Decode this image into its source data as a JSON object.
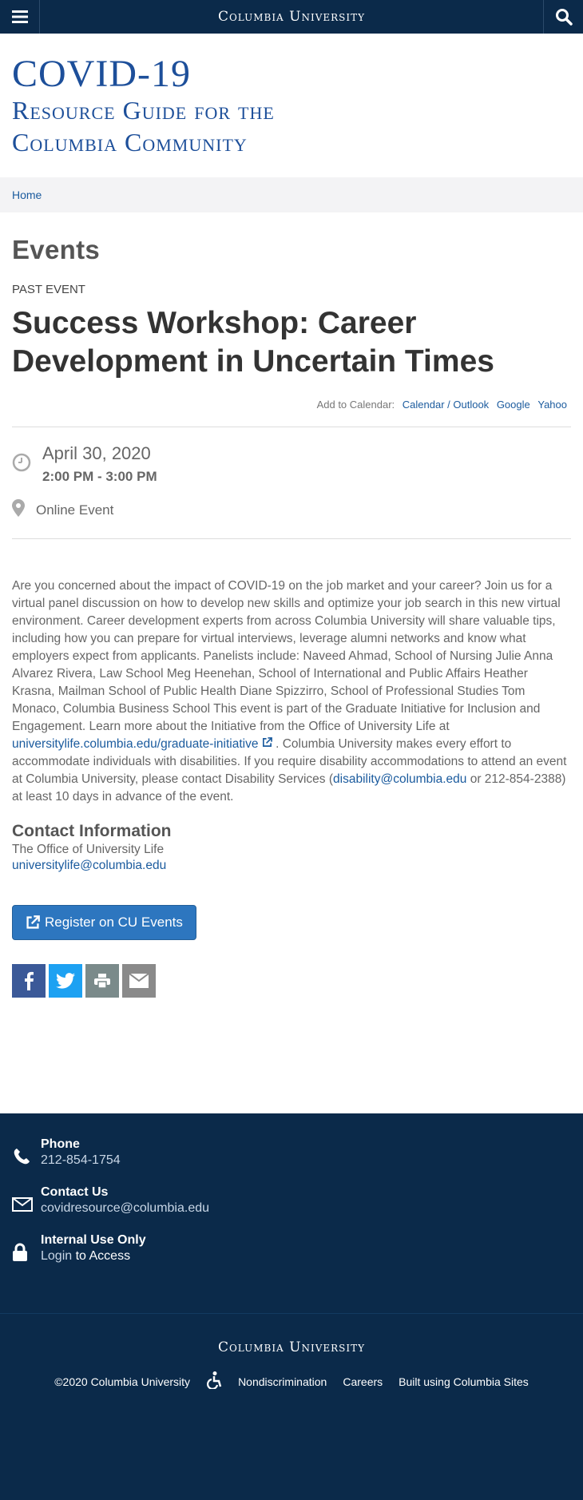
{
  "topbar": {
    "brand": "Columbia University",
    "menu_icon": "hamburger-menu-icon",
    "search_icon": "search-icon"
  },
  "site": {
    "title_line1": "COVID-19",
    "title_line2": "Resource Guide for the",
    "title_line3": "Columbia Community"
  },
  "breadcrumb": {
    "home": "Home"
  },
  "main": {
    "section_title": "Events",
    "event_label": "PAST EVENT",
    "event_title": "Success Workshop: Career Development in Uncertain Times",
    "calendar": {
      "label": "Add to Calendar:",
      "links": [
        "Calendar / Outlook",
        "Google",
        "Yahoo"
      ]
    },
    "date": "April 30, 2020",
    "time": "2:00 PM - 3:00 PM",
    "location": "Online Event",
    "description_part1": "Are you concerned about the impact of COVID-19 on the job market and your career? Join us for a virtual panel discussion on how to develop new skills and optimize your job search in this new virtual environment. Career development experts from across Columbia University will share valuable tips, including how you can prepare for virtual interviews, leverage alumni networks and know what employers expect from applicants. Panelists include: Naveed Ahmad, School of Nursing Julie Anna Alvarez Rivera, Law School Meg Heenehan, School of International and Public Affairs Heather Krasna, Mailman School of Public Health Diane Spizzirro, School of Professional Studies Tom Monaco, Columbia Business School This event is part of the Graduate Initiative for Inclusion and Engagement. Learn more about the Initiative from the Office of University Life at",
    "description_link1": "universitylife.columbia.edu/graduate-initiative",
    "description_part2": ". Columbia University makes every effort to accommodate individuals with disabilities. If you require disability accommodations to attend an event at Columbia University, please contact Disability Services (",
    "description_link2": "disability@columbia.edu",
    "description_part3": " or 212-854-2388) at least 10 days in advance of the event.",
    "contact": {
      "heading": "Contact Information",
      "office": "The Office of University Life",
      "email": "universitylife@columbia.edu"
    },
    "register_label": "Register on CU Events",
    "share_icons": [
      "facebook-icon",
      "twitter-icon",
      "print-icon",
      "email-icon"
    ]
  },
  "footer_contact": {
    "phone_title": "Phone",
    "phone_value": "212-854-1754",
    "contact_title": "Contact Us",
    "contact_value": "covidresource@columbia.edu",
    "internal_title": "Internal Use Only",
    "login_link": "Login",
    "login_suffix": " to Access"
  },
  "footer_bottom": {
    "brand": "Columbia University",
    "copyright": "©2020 Columbia University",
    "accessibility_icon": "accessibility-icon",
    "links": [
      "Nondiscrimination",
      "Careers",
      "Built using Columbia Sites"
    ]
  },
  "colors": {
    "navy": "#0b2a4a",
    "title_blue": "#1d4f9a",
    "link_blue": "#1b5b9e",
    "button_blue": "#2d76bf"
  }
}
